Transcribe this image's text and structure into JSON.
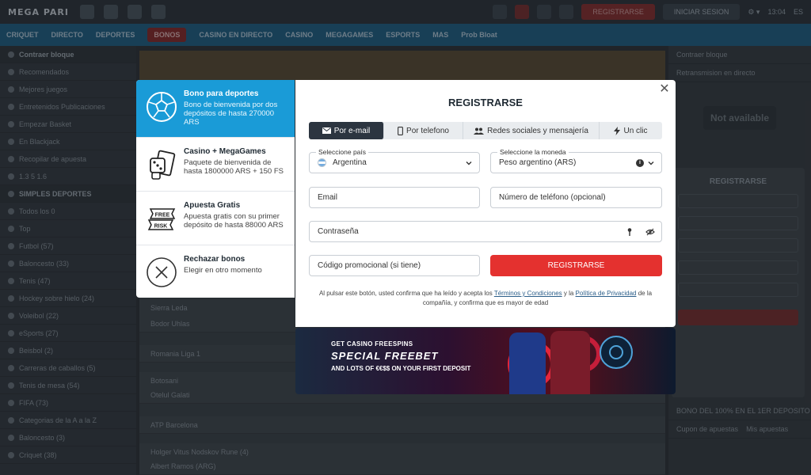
{
  "background": {
    "logo": "MEGA PARI",
    "top_register": "REGISTRARSE",
    "top_login": "INICIAR SESION",
    "top_time": "13:04",
    "top_lang": "ES",
    "nav": [
      "CRIQUET",
      "DIRECTO",
      "DEPORTES",
      "BONOS",
      "CASINO EN DIRECTO",
      "CASINO",
      "MEGAGAMES",
      "ESPORTS",
      "MAS",
      "Prob Bloat"
    ],
    "left_rows": [
      "Contraer bloque",
      "Recomendados",
      "Mejores juegos",
      "Entretenidos Publicaciones",
      "Empezar Basket",
      "En Blackjack",
      "Recopilar de apuesta",
      "1.3 5  1.6",
      "SIMPLES  DEPORTES",
      "Todos los  0",
      "Top",
      "Futbol (57)",
      "Baloncesto (33)",
      "Tenis (47)",
      "Hockey sobre hielo (24)",
      "Voleibol (22)",
      "eSports (27)",
      "Beisbol (2)",
      "Carreras de caballos (5)",
      "Tenis de mesa (54)",
      "FIFA (73)",
      "Categorias de la A a la Z",
      "Baloncesto (3)",
      "Criquet (38)"
    ],
    "main_rows": [
      "Sierra Leda",
      "Bodor Uhlas",
      "Romania Liga 1",
      "Botosani",
      "Otelul Galati",
      "ATP Barcelona",
      "Holger Vitus Nodskov Rune (4)",
      "Albert Ramos (ARG)"
    ],
    "right_rows": [
      "Contraer bloque",
      "Retransmision en directo",
      "BONO DEL 100% EN EL 1ER DEPOSITO",
      "Cupon de apuestas",
      "Mis apuestas"
    ],
    "not_available": "Not available",
    "mini_title": "REGISTRARSE"
  },
  "bonuses": [
    {
      "title": "Bono para deportes",
      "desc": "Bono de bienvenida por dos depósitos de hasta 270000 ARS",
      "icon": "soccer-ball-icon"
    },
    {
      "title": "Casino + MegaGames",
      "desc": "Paquete de bienvenida de hasta 1800000 ARS + 150 FS",
      "icon": "casino-cards-icon"
    },
    {
      "title": "Apuesta Gratis",
      "desc": "Apuesta gratis con su primer depósito de hasta 88000 ARS",
      "icon": "free-risk-icon",
      "icon_text": [
        "FREE",
        "RISK"
      ]
    },
    {
      "title": "Rechazar bonos",
      "desc": "Elegir en otro momento",
      "icon": "reject-x-icon"
    }
  ],
  "modal": {
    "title": "REGISTRARSE",
    "tabs": [
      "Por e-mail",
      "Por telefono",
      "Redes sociales y mensajería",
      "Un clic"
    ],
    "country_label": "Seleccione país",
    "country_value": "Argentina",
    "currency_label": "Seleccione la moneda",
    "currency_value": "Peso argentino (ARS)",
    "email_placeholder": "Email",
    "phone_placeholder": "Número de teléfono (opcional)",
    "password_placeholder": "Contraseña",
    "promo_placeholder": "Código promocional (si tiene)",
    "register_button": "REGISTRARSE",
    "legal_before": "Al pulsar este botón, usted confirma que ha leído y acepta los ",
    "terms_link": "Términos y Condiciones",
    "legal_middle": " y la ",
    "privacy_link": "Política de Privacidad",
    "legal_after": " de la compañía, y confirma que es mayor de edad"
  },
  "banner": {
    "line1": "GET CASINO FREESPINS",
    "line2": "SPECIAL FREEBET",
    "line3": "AND LOTS OF €€$$ ON YOUR FIRST DEPOSIT"
  },
  "colors": {
    "accent_blue": "#1a9bd7",
    "register_red": "#e4312f",
    "tab_dark": "#2c3540"
  }
}
